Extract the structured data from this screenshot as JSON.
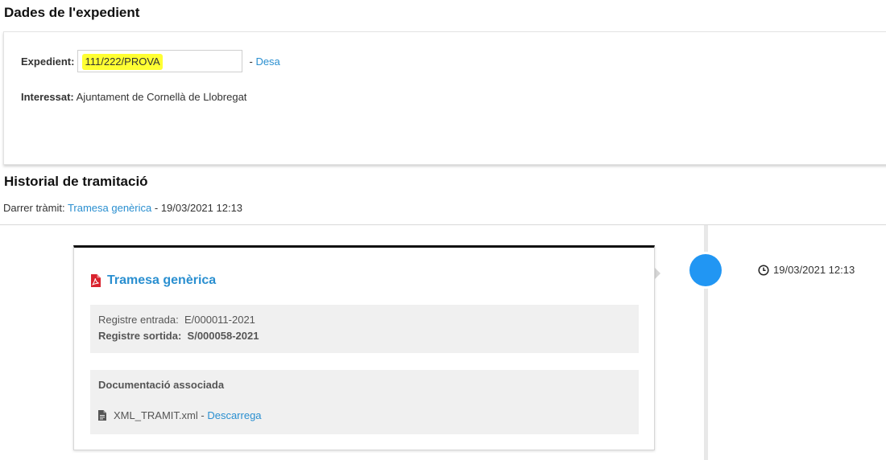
{
  "expedient_section": {
    "title": "Dades de l'expedient",
    "expedient_label": "Expedient:",
    "expedient_value": "111/222/PROVA",
    "save_separator": "-",
    "save_link": "Desa",
    "interessat_label": "Interessat:",
    "interessat_value": "Ajuntament de Cornellà de Llobregat"
  },
  "history_section": {
    "title": "Historial de tramitació",
    "last_label": "Darrer tràmit:",
    "last_link": "Tramesa genèrica",
    "last_date": "- 19/03/2021 12:13"
  },
  "timeline": {
    "date": "19/03/2021 12:13",
    "dot_color": "#2196f3",
    "card": {
      "icon": "pdf-icon",
      "title": "Tramesa genèrica",
      "registre_entrada_label": "Registre entrada:",
      "registre_entrada_value": "E/000011-2021",
      "registre_sortida_label": "Registre sortida:",
      "registre_sortida_value": "S/000058-2021",
      "doc_heading": "Documentació associada",
      "doc_icon": "file-icon",
      "doc_name": "XML_TRAMIT.xml",
      "doc_separator": "-",
      "doc_link": "Descarrega"
    }
  },
  "colors": {
    "link": "#2a8fd0",
    "highlight": "#ffff33",
    "pdf": "#d9232e"
  }
}
